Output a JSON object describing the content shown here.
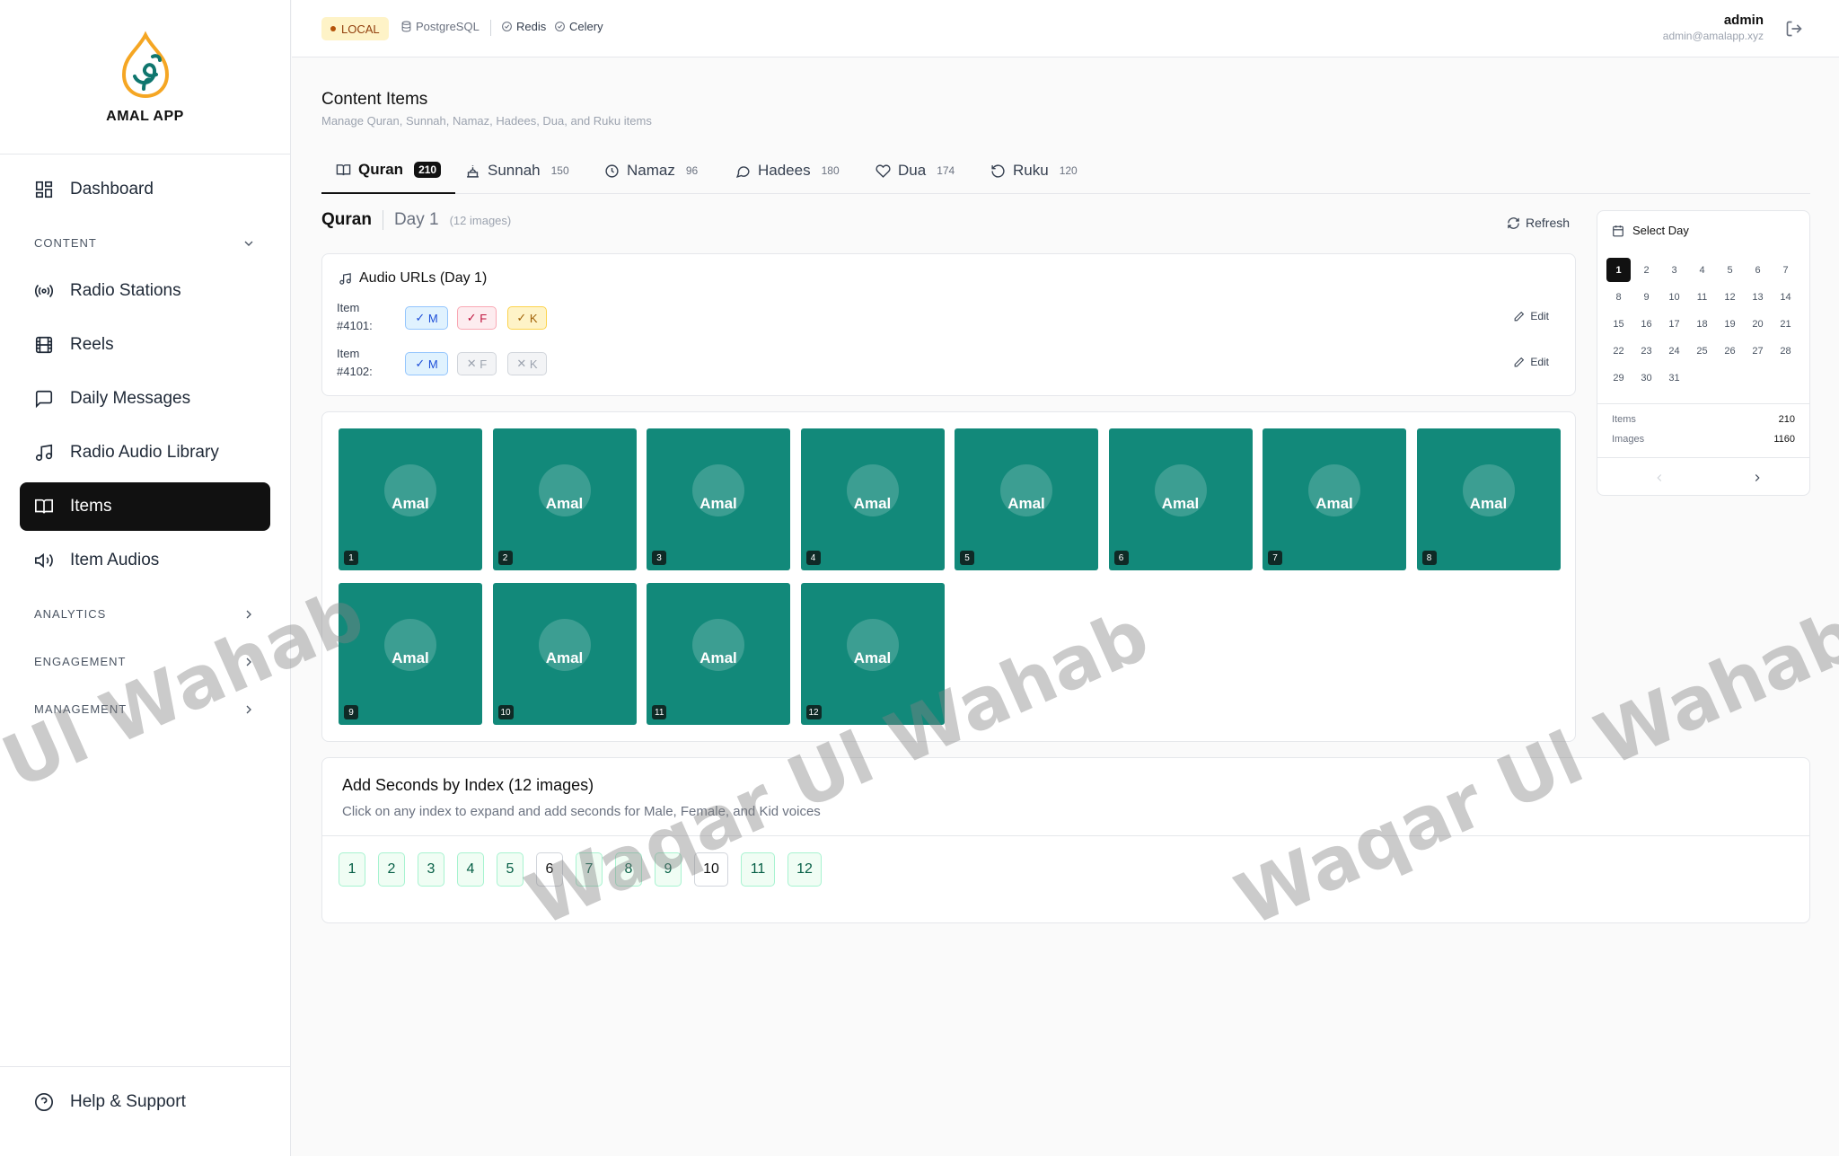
{
  "app": {
    "name": "AMAL APP"
  },
  "sidebar": {
    "nav": [
      {
        "label": "Dashboard",
        "icon": "dashboard-icon"
      },
      {
        "label": "Radio Stations",
        "icon": "radio-icon"
      },
      {
        "label": "Reels",
        "icon": "film-icon"
      },
      {
        "label": "Daily Messages",
        "icon": "message-icon"
      },
      {
        "label": "Radio Audio Library",
        "icon": "music-icon"
      },
      {
        "label": "Items",
        "icon": "book-icon",
        "active": true
      },
      {
        "label": "Item Audios",
        "icon": "speaker-icon"
      }
    ],
    "sections": {
      "content": "CONTENT",
      "analytics": "ANALYTICS",
      "engagement": "ENGAGEMENT",
      "management": "MANAGEMENT"
    },
    "help": "Help & Support"
  },
  "topbar": {
    "env": "LOCAL",
    "services": [
      "PostgreSQL",
      "Redis",
      "Celery"
    ],
    "user_name": "admin",
    "user_email": "admin@amalapp.xyz"
  },
  "page": {
    "title": "Content Items",
    "subtitle": "Manage Quran, Sunnah, Namaz, Hadees, Dua, and Ruku items"
  },
  "tabs": [
    {
      "label": "Quran",
      "count": "210",
      "active": true
    },
    {
      "label": "Sunnah",
      "count": "150"
    },
    {
      "label": "Namaz",
      "count": "96"
    },
    {
      "label": "Hadees",
      "count": "180"
    },
    {
      "label": "Dua",
      "count": "174"
    },
    {
      "label": "Ruku",
      "count": "120"
    }
  ],
  "section_header": {
    "name": "Quran",
    "day": "Day 1",
    "count": "(12 images)",
    "refresh": "Refresh"
  },
  "audio": {
    "title": "Audio URLs (Day 1)",
    "edit_label": "Edit",
    "rows": [
      {
        "label_a": "Item",
        "label_b": "#4101:",
        "m": "M",
        "f": "F",
        "k": "K",
        "m_on": true,
        "f_on": true,
        "k_on": true
      },
      {
        "label_a": "Item",
        "label_b": "#4102:",
        "m": "M",
        "f": "F",
        "k": "K",
        "m_on": true,
        "f_on": false,
        "k_on": false
      }
    ]
  },
  "images": {
    "tile_text": "Amal",
    "indices": [
      "1",
      "2",
      "3",
      "4",
      "5",
      "6",
      "7",
      "8",
      "9",
      "10",
      "11",
      "12"
    ]
  },
  "calendar": {
    "title": "Select Day",
    "selected": "1",
    "days": [
      "1",
      "2",
      "3",
      "4",
      "5",
      "6",
      "7",
      "8",
      "9",
      "10",
      "11",
      "12",
      "13",
      "14",
      "15",
      "16",
      "17",
      "18",
      "19",
      "20",
      "21",
      "22",
      "23",
      "24",
      "25",
      "26",
      "27",
      "28",
      "29",
      "30",
      "31"
    ],
    "items_label": "Items",
    "items_value": "210",
    "images_label": "Images",
    "images_value": "1160"
  },
  "seconds": {
    "title": "Add Seconds by Index (12 images)",
    "subtitle": "Click on any index to expand and add seconds for Male, Female, and Kid voices",
    "indices": [
      "1",
      "2",
      "3",
      "4",
      "5",
      "6",
      "7",
      "8",
      "9",
      "10",
      "11",
      "12"
    ],
    "neutral": [
      "6",
      "10"
    ]
  },
  "watermark": {
    "text1": "Ul Wahab",
    "text2": "Waqar Ul Wahab",
    "text3": "Waqar Ul Wahab"
  },
  "colors": {
    "tile": "#12897a",
    "active_nav": "#111111",
    "env_badge": "#fef3c7"
  }
}
